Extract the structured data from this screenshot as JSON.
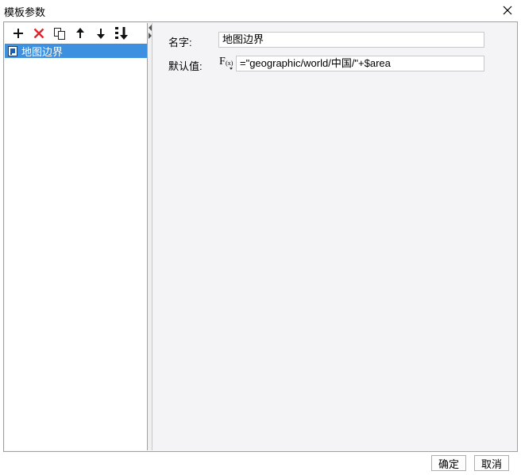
{
  "window": {
    "title": "模板参数"
  },
  "toolbar": {
    "buttons": [
      {
        "name": "add-button",
        "icon": "plus-icon"
      },
      {
        "name": "delete-button",
        "icon": "x-icon"
      },
      {
        "name": "copy-button",
        "icon": "copy-icon"
      },
      {
        "name": "move-up-button",
        "icon": "arrow-up-icon"
      },
      {
        "name": "move-down-button",
        "icon": "arrow-down-icon"
      },
      {
        "name": "sort-button",
        "icon": "sort-icon"
      }
    ]
  },
  "params": [
    {
      "label": "地图边界",
      "selected": true
    }
  ],
  "form": {
    "name_label": "名字:",
    "name_value": "地图边界",
    "default_label": "默认值:",
    "default_value": "=\"geographic/world/中国/\"+$area"
  },
  "footer": {
    "ok_label": "确定",
    "cancel_label": "取消"
  },
  "colors": {
    "selection": "#3d8fe0",
    "delete": "#e0242c"
  }
}
